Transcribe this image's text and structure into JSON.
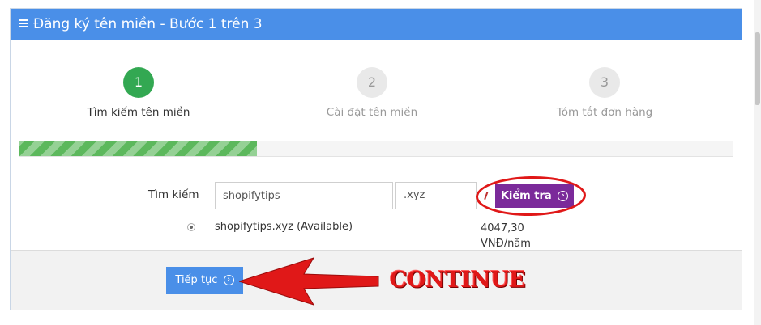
{
  "header": {
    "title": "Đăng ký tên miền - Bước 1 trên 3"
  },
  "steps": [
    {
      "number": "1",
      "label": "Tìm kiếm tên miền",
      "state": "active"
    },
    {
      "number": "2",
      "label": "Cài đặt tên miền",
      "state": "inactive"
    },
    {
      "number": "3",
      "label": "Tóm tắt đơn hàng",
      "state": "inactive"
    }
  ],
  "progress": {
    "fraction": 0.333
  },
  "search": {
    "label": "Tìm kiếm",
    "domain_value": "shopifytips",
    "tld_value": ".xyz",
    "check_label": "Kiểm tra"
  },
  "result": {
    "domain": "shopifytips.xyz (Available)",
    "price": "4047,30",
    "unit": "VNĐ/năm"
  },
  "footer": {
    "continue_label": "Tiếp tục"
  },
  "annotation": {
    "text": "CONTINUE"
  },
  "colors": {
    "header_bg": "#4a8fe8",
    "step_active": "#33a852",
    "check_button": "#7b2a9a",
    "annotation_red": "#e01818"
  },
  "icons": {
    "menu": "hamburger-icon",
    "arrow_circle": "arrow-circle-right-icon"
  }
}
